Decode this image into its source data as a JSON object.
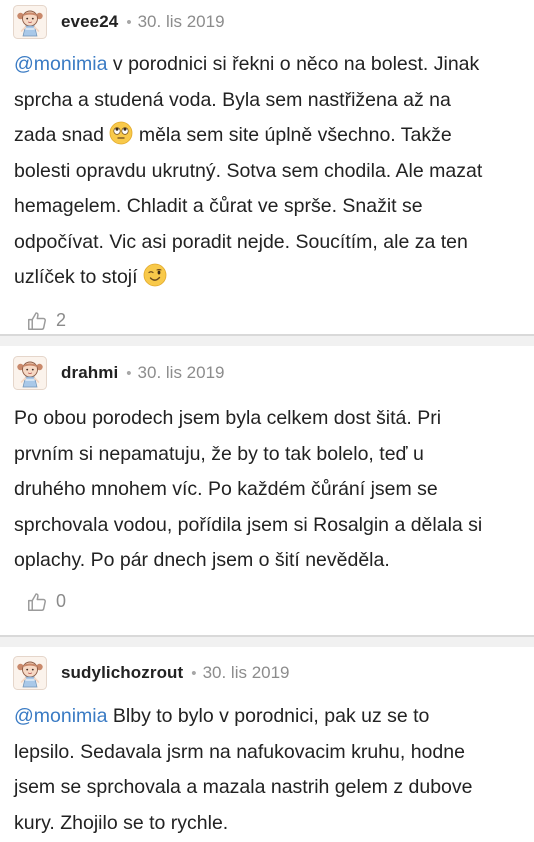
{
  "comments": [
    {
      "username": "evee24",
      "separator": "•",
      "date": "30. lis 2019",
      "mention": "@monimia",
      "lines": [
        " v porodnici si řekni o něco na bolest. Jinak",
        "sprcha a studená voda. Byla sem nastřižena až na",
        "zada snad ",
        " měla sem site úplně všechno. Takže",
        "bolesti opravdu ukrutný. Sotva sem chodila. Ale mazat",
        "hemagelem. Chladit a čůrat ve sprše. Snažit se",
        "odpočívat. Vic asi poradit nejde. Soucítím, ale za ten",
        "uzlíček to stojí "
      ],
      "emojis": [
        "rolling-eyes-emoji",
        "winking-face-emoji"
      ],
      "likes": "2"
    },
    {
      "username": "drahmi",
      "separator": "•",
      "date": "30. lis 2019",
      "lines": [
        "Po obou porodech jsem byla celkem dost šitá. Pri",
        "prvním si nepamatuju, že by to tak bolelo, teď u",
        "druhého mnohem víc. Po každém čůrání jsem se",
        "sprchovala vodou, pořídila jsem si Rosalgin a dělala si",
        "oplachy. Po pár dnech jsem o šití nevěděla."
      ],
      "likes": "0"
    },
    {
      "username": "sudylichozrout",
      "separator": "•",
      "date": "30. lis 2019",
      "mention": "@monimia",
      "lines": [
        " Blby to bylo v porodnici, pak uz se to",
        "lepsilo. Sedavala jsrm na nafukovacim kruhu, hodne",
        "jsem se sprchovala a mazala nastrih gelem z dubove",
        "kury. Zhojilo se to rychle."
      ]
    }
  ],
  "colors": {
    "mention": "#3a7bc4",
    "divider_bg": "#f1f1f1",
    "text": "#222222",
    "meta": "#8c8c8c"
  },
  "icons": {
    "avatar": "baby-avatar-icon",
    "like": "thumbs-up-icon"
  }
}
